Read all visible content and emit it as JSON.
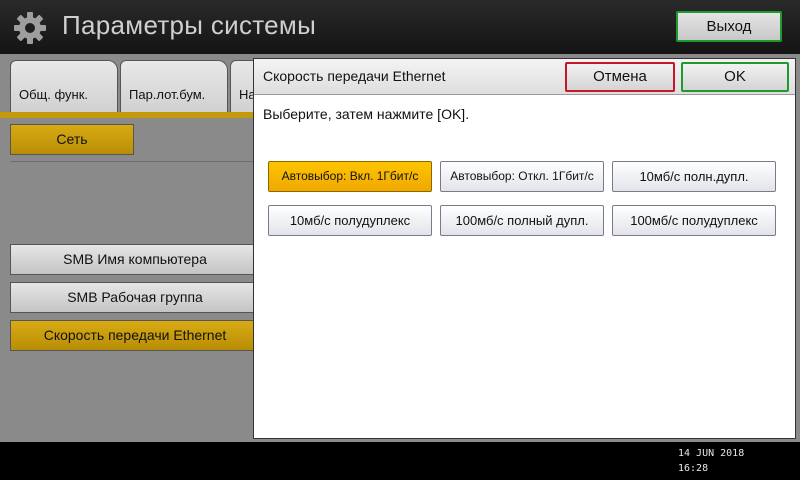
{
  "header": {
    "title": "Параметры системы",
    "exit_label": "Выход",
    "icon": "gear-icon"
  },
  "tabs": [
    {
      "label": "Общ. функ."
    },
    {
      "label": "Пар.лот.бум."
    },
    {
      "label": "На"
    }
  ],
  "left_panel": {
    "network_button": "Сеть",
    "items": [
      {
        "label": "SMB Имя компьютера",
        "selected": false
      },
      {
        "label": "SMB Рабочая группа",
        "selected": false
      },
      {
        "label": "Скорость передачи Ethernet",
        "selected": true
      }
    ]
  },
  "dialog": {
    "title": "Скорость передачи Ethernet",
    "cancel_label": "Отмена",
    "ok_label": "OK",
    "instruction": "Выберите, затем нажмите [OK].",
    "options": [
      {
        "label": "Автовыбор: Вкл. 1Гбит/с",
        "selected": true
      },
      {
        "label": "Автовыбор: Откл. 1Гбит/с",
        "selected": false
      },
      {
        "label": "10мб/с полн.дупл.",
        "selected": false
      },
      {
        "label": "10мб/с полудуплекс",
        "selected": false
      },
      {
        "label": "100мб/с полный дупл.",
        "selected": false
      },
      {
        "label": "100мб/с полудуплекс",
        "selected": false
      }
    ]
  },
  "status": {
    "date": "14 JUN  2018",
    "time": "16:28"
  },
  "colors": {
    "selected": "#ffc400",
    "gold_button": "#c49a0b",
    "ok_border": "#1f9a2d",
    "cancel_border": "#c4182a"
  }
}
